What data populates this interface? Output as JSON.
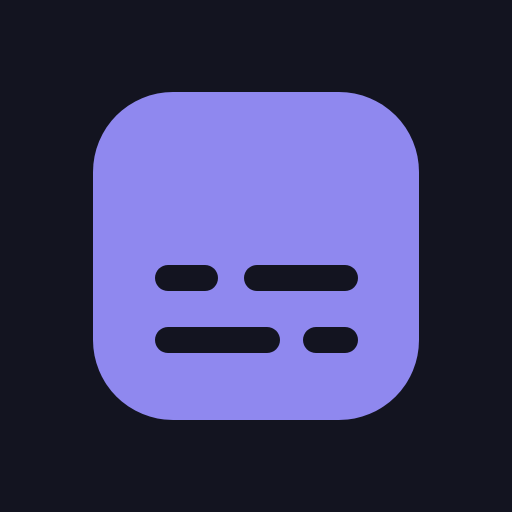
{
  "icon": {
    "name": "subtitles-icon",
    "background_color": "#131420",
    "tile_color": "#8f88ef",
    "bar_color": "#131420"
  }
}
